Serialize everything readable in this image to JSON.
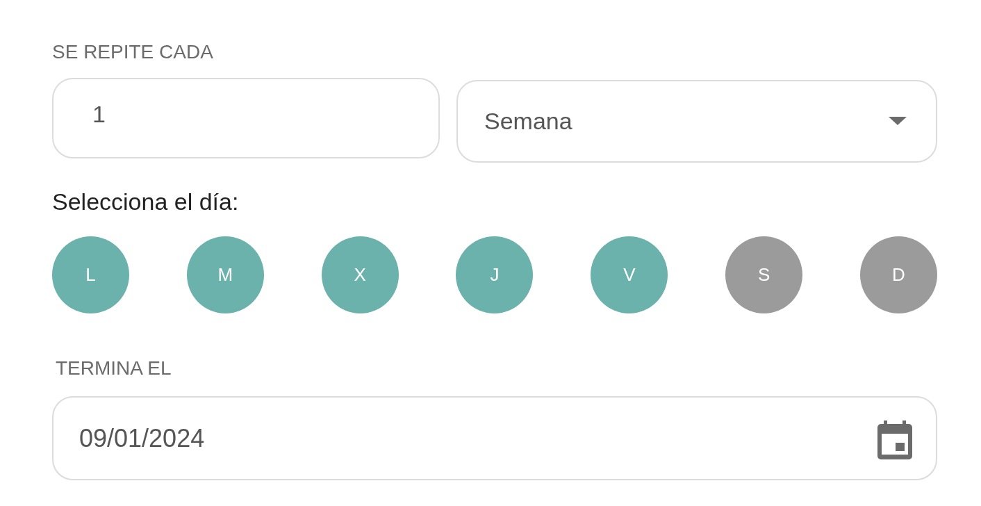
{
  "repeat": {
    "label": "SE REPITE CADA",
    "interval": {
      "value": "1"
    },
    "unit": {
      "value": "Semana"
    }
  },
  "day_picker": {
    "label": "Selecciona el día:",
    "days": [
      {
        "label": "L",
        "selected": true
      },
      {
        "label": "M",
        "selected": true
      },
      {
        "label": "X",
        "selected": true
      },
      {
        "label": "J",
        "selected": true
      },
      {
        "label": "V",
        "selected": true
      },
      {
        "label": "S",
        "selected": false
      },
      {
        "label": "D",
        "selected": false
      }
    ]
  },
  "end_date": {
    "label": "TERMINA EL",
    "value": "09/01/2024"
  }
}
